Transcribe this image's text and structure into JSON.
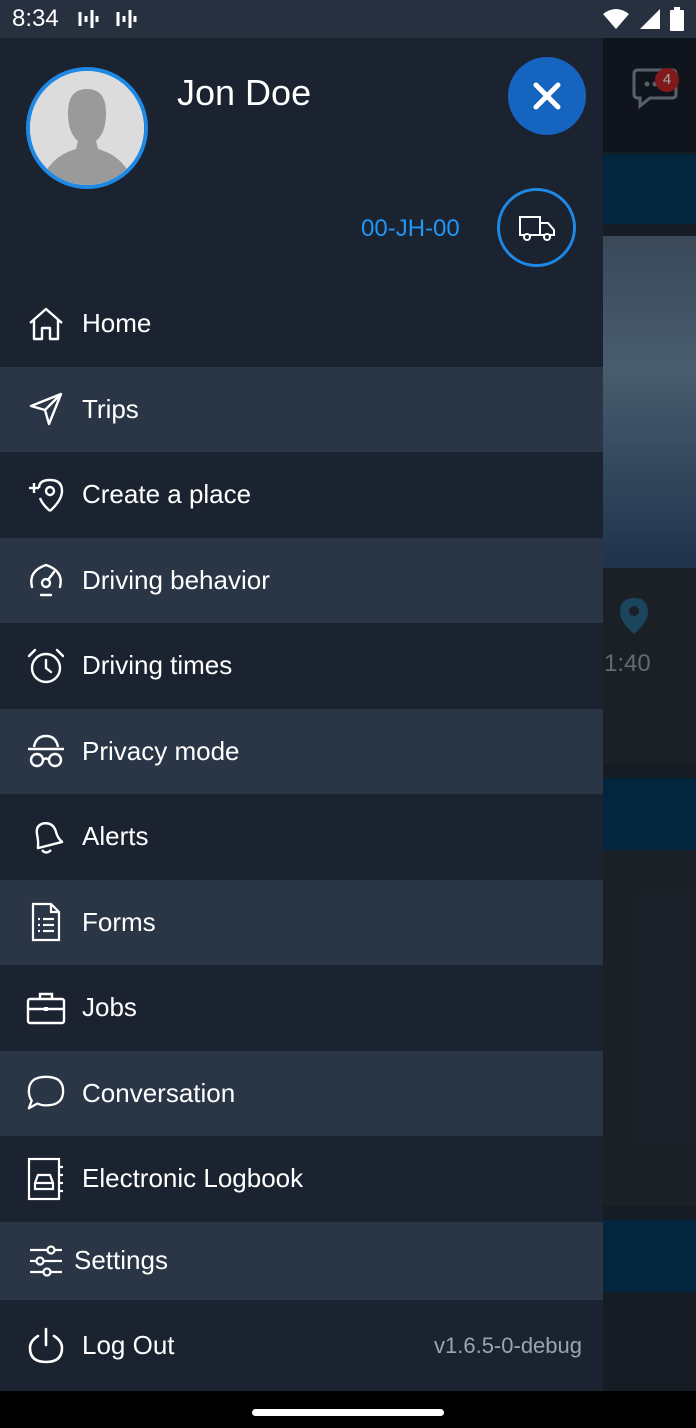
{
  "status_bar": {
    "time": "8:34"
  },
  "background": {
    "chat_badge": "4",
    "time_text": "1:40"
  },
  "profile": {
    "name": "Jon Doe",
    "vehicle_id": "00-JH-00"
  },
  "menu": {
    "items": [
      {
        "label": "Home",
        "icon": "home-icon"
      },
      {
        "label": "Trips",
        "icon": "send-icon"
      },
      {
        "label": "Create a place",
        "icon": "add-location-icon"
      },
      {
        "label": "Driving behavior",
        "icon": "speedometer-icon"
      },
      {
        "label": "Driving times",
        "icon": "alarm-clock-icon"
      },
      {
        "label": "Privacy mode",
        "icon": "incognito-icon"
      },
      {
        "label": "Alerts",
        "icon": "bell-icon"
      },
      {
        "label": "Forms",
        "icon": "document-icon"
      },
      {
        "label": "Jobs",
        "icon": "briefcase-icon"
      },
      {
        "label": "Conversation",
        "icon": "chat-bubble-icon"
      },
      {
        "label": "Electronic Logbook",
        "icon": "logbook-icon"
      },
      {
        "label": "Settings",
        "icon": "sliders-icon"
      },
      {
        "label": "Log Out",
        "icon": "power-icon"
      }
    ]
  },
  "version": "v1.6.5-0-debug",
  "colors": {
    "drawer": "#1b2230",
    "alt_row": "#2a3546",
    "accent": "#1e88e5",
    "close_button": "#1565c0"
  }
}
